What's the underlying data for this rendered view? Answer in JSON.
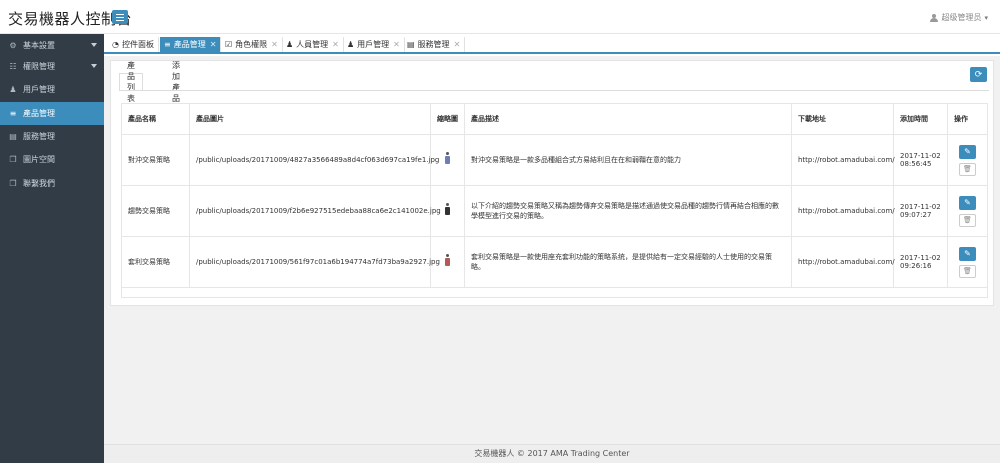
{
  "header": {
    "brand": "交易機器人控制台",
    "user_label": "超级管理员",
    "caret": "▾"
  },
  "sidebar": {
    "items": [
      {
        "label": "基本設置",
        "icon": "gear-icon",
        "glyph": "⚙",
        "has_arrow": true,
        "active": false
      },
      {
        "label": "權限管理",
        "icon": "users-icon",
        "glyph": "☷",
        "has_arrow": true,
        "active": false
      },
      {
        "label": "用戶管理",
        "icon": "user-icon",
        "glyph": "♟",
        "has_arrow": false,
        "active": false
      },
      {
        "label": "產品管理",
        "icon": "sliders-icon",
        "glyph": "≡",
        "has_arrow": false,
        "active": true
      },
      {
        "label": "服務管理",
        "icon": "document-icon",
        "glyph": "▤",
        "has_arrow": false,
        "active": false
      },
      {
        "label": "圖片空間",
        "icon": "copy-icon",
        "glyph": "❐",
        "has_arrow": false,
        "active": false
      },
      {
        "label": "聯繫我們",
        "icon": "copy-icon",
        "glyph": "❐",
        "has_arrow": false,
        "active": false
      }
    ]
  },
  "tabs": [
    {
      "label": "控件面板",
      "icon": "dashboard-icon",
      "glyph": "◔",
      "closable": false,
      "active": false
    },
    {
      "label": "產品管理",
      "icon": "sliders-icon",
      "glyph": "≡",
      "closable": true,
      "active": true
    },
    {
      "label": "角色權限",
      "icon": "check-square-icon",
      "glyph": "☑",
      "closable": true,
      "active": false
    },
    {
      "label": "人員管理",
      "icon": "user-icon",
      "glyph": "♟",
      "closable": true,
      "active": false
    },
    {
      "label": "用戶管理",
      "icon": "user-icon",
      "glyph": "♟",
      "closable": true,
      "active": false
    },
    {
      "label": "服務管理",
      "icon": "document-icon",
      "glyph": "▤",
      "closable": true,
      "active": false
    }
  ],
  "close_glyph": "✕",
  "subtabs": {
    "list": "產品列表",
    "add": "添加產品"
  },
  "table": {
    "headers": {
      "name": "產品名稱",
      "image": "產品圖片",
      "thumb": "縮略圖",
      "desc": "產品描述",
      "download": "下載地址",
      "time": "添加時間",
      "ops": "操作"
    },
    "rows": [
      {
        "name": "對沖交易策略",
        "image": "/public/uploads/20171009/4827a3566489a8d4cf063d697ca19fe1.jpg",
        "thumb_color": "blue",
        "desc": "對沖交易策略是一款多品種組合式方易結利且在在和弱韁在意的能力",
        "download": "http://robot.amadubai.com/",
        "date": "2017-11-02",
        "time": "08:56:45"
      },
      {
        "name": "趨勢交易策略",
        "image": "/public/uploads/20171009/f2b6e927515edebaa88ca6e2c141002e.jpg",
        "thumb_color": "dark",
        "desc": "以下介紹的趨勢交易策略又稱為趨勢傳弃交易策略是描述通過使交易品種的趨勢行情再結合相應的數學模型進行交易的策略。",
        "download": "http://robot.amadubai.com/",
        "date": "2017-11-02",
        "time": "09:07:27"
      },
      {
        "name": "套利交易策略",
        "image": "/public/uploads/20171009/561f97c01a6b194774a7fd73ba9a2927.jpg",
        "thumb_color": "red",
        "desc": "套利交易策略是一款使用座充套利功能的策略系统，是提供給有一定交易經驗的人士使用的交易策略。",
        "download": "http://robot.amadubai.com/",
        "date": "2017-11-02",
        "time": "09:26:16"
      }
    ]
  },
  "footer": "交易機器人 © 2017   AMA Trading Center",
  "colors": {
    "accent": "#3c8dbc",
    "sidebar_bg": "#313c47"
  }
}
